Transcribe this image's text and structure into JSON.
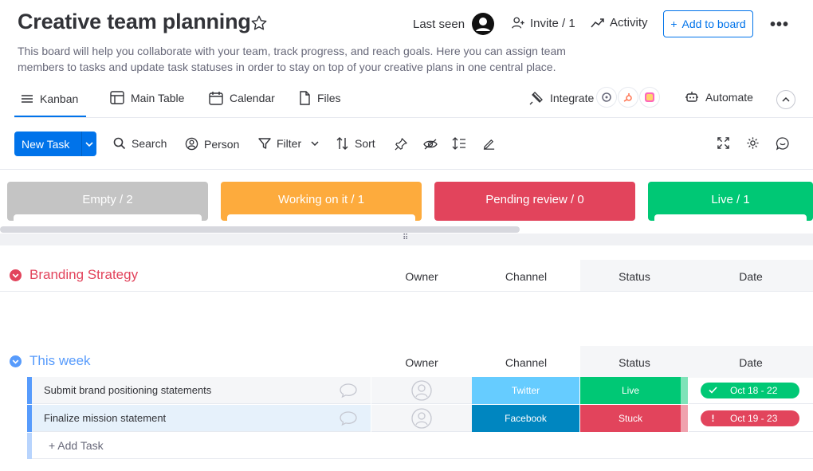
{
  "board": {
    "title": "Creative team planning",
    "description": "This board will help you collaborate with your team, track progress, and reach goals. Here you can assign team members to tasks and update task statuses in order to stay on top of your creative plans in one central place."
  },
  "header": {
    "last_seen_label": "Last seen",
    "invite_label": "Invite / 1",
    "activity_label": "Activity",
    "add_to_board_label": "Add to board",
    "more_label": "•••"
  },
  "views": {
    "tabs": [
      {
        "label": "Kanban",
        "icon": "menu-icon",
        "active": true
      },
      {
        "label": "Main Table",
        "icon": "table-icon"
      },
      {
        "label": "Calendar",
        "icon": "calendar-icon"
      },
      {
        "label": "Files",
        "icon": "file-icon"
      }
    ],
    "integrate_label": "Integrate",
    "automate_label": "Automate"
  },
  "toolbar": {
    "new_task_label": "New Task",
    "search_label": "Search",
    "person_label": "Person",
    "filter_label": "Filter",
    "sort_label": "Sort"
  },
  "kanban": {
    "lanes": [
      {
        "label": "Empty / 2",
        "color": "#c4c4c4"
      },
      {
        "label": "Working on it / 1",
        "color": "#fdab3d"
      },
      {
        "label": "Pending review / 0",
        "color": "#e2445c"
      },
      {
        "label": "Live / 1",
        "color": "#00c875"
      }
    ]
  },
  "groups": [
    {
      "title": "Branding Strategy",
      "color": "#e2445c",
      "columns": {
        "owner": "Owner",
        "channel": "Channel",
        "status": "Status",
        "date": "Date"
      }
    },
    {
      "title": "This week",
      "color": "#579bfc",
      "columns": {
        "owner": "Owner",
        "channel": "Channel",
        "status": "Status",
        "date": "Date"
      },
      "rows": [
        {
          "name": "Submit brand positioning statements",
          "channel": "Twitter",
          "channel_color": "#66ccff",
          "status": "Live",
          "status_color": "#00c875",
          "date": "Oct 18 - 22",
          "date_color": "#00c875"
        },
        {
          "name": "Finalize mission statement",
          "channel": "Facebook",
          "channel_color": "#0086c0",
          "status": "Stuck",
          "status_color": "#e2445c",
          "date": "Oct 19 - 23",
          "date_color": "#e2445c"
        }
      ],
      "add_task_label": "+ Add Task"
    }
  ]
}
